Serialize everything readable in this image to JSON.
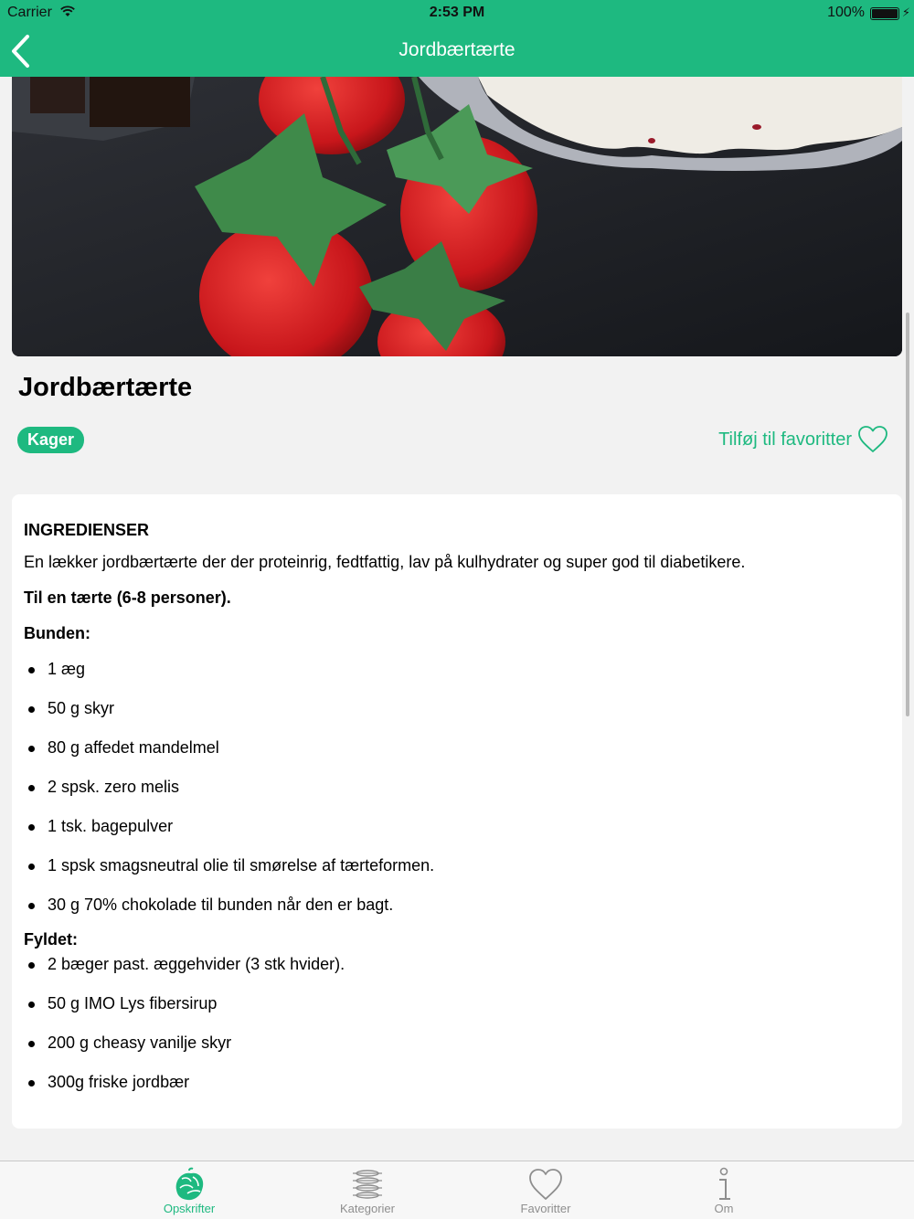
{
  "status_bar": {
    "carrier": "Carrier",
    "time": "2:53 PM",
    "battery": "100%"
  },
  "nav": {
    "title": "Jordbærtærte"
  },
  "recipe": {
    "title": "Jordbærtærte",
    "category": "Kager",
    "favorite_label": "Tilføj til favoritter"
  },
  "content": {
    "heading": "INGREDIENSER",
    "intro": "En lækker jordbærtærte der der proteinrig, fedtfattig, lav på kulhydrater og super god til diabetikere.",
    "serving": "Til en tærte (6-8 personer).",
    "base_title": "Bunden:",
    "base_items": [
      "1 æg",
      "50 g skyr",
      "80 g affedet mandelmel",
      "2 spsk. zero melis",
      "1 tsk. bagepulver",
      "1 spsk smagsneutral olie til smørelse af tærteformen.",
      "30 g 70% chokolade til bunden når den er bagt."
    ],
    "filling_title": "Fyldet:",
    "filling_items": [
      "2 bæger past. æggehvider (3 stk hvider).",
      "50 g IMO Lys fibersirup",
      "200 g cheasy vanilje skyr",
      "300g friske jordbær"
    ]
  },
  "tabs": [
    {
      "label": "Opskrifter",
      "icon": "recipes-icon",
      "active": true
    },
    {
      "label": "Kategorier",
      "icon": "categories-icon",
      "active": false
    },
    {
      "label": "Favoritter",
      "icon": "heart-icon",
      "active": false
    },
    {
      "label": "Om",
      "icon": "info-icon",
      "active": false
    }
  ],
  "colors": {
    "accent": "#1eb980",
    "background": "#f2f2f2",
    "tab_inactive": "#8e8e8e"
  }
}
